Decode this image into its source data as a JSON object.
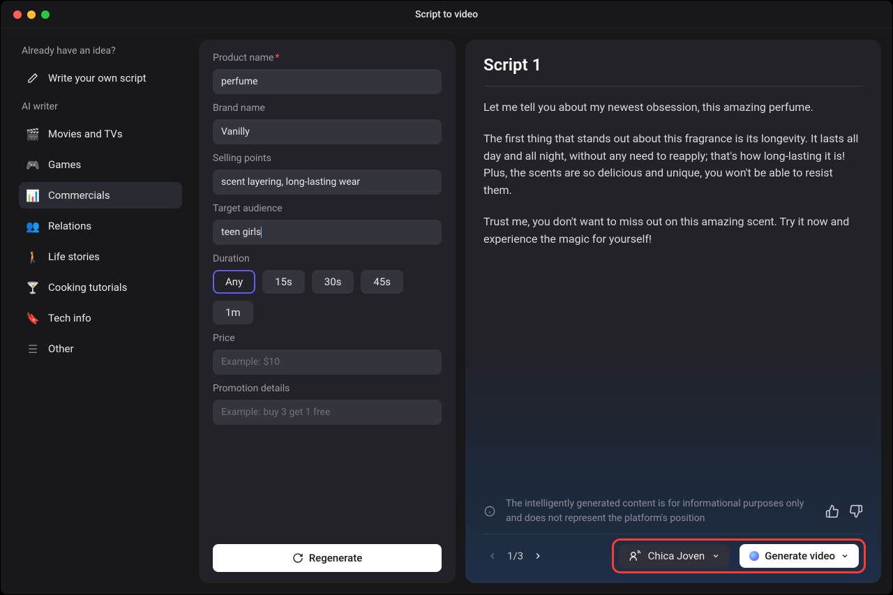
{
  "window": {
    "title": "Script to video"
  },
  "sidebar": {
    "idea_header": "Already have an idea?",
    "write_own": "Write your own script",
    "ai_header": "AI writer",
    "items": [
      {
        "icon": "movie",
        "label": "Movies and TVs"
      },
      {
        "icon": "game",
        "label": "Games"
      },
      {
        "icon": "commercial",
        "label": "Commercials"
      },
      {
        "icon": "relation",
        "label": "Relations"
      },
      {
        "icon": "life",
        "label": "Life stories"
      },
      {
        "icon": "cook",
        "label": "Cooking tutorials"
      },
      {
        "icon": "tech",
        "label": "Tech info"
      },
      {
        "icon": "other",
        "label": "Other"
      }
    ],
    "active_index": 2
  },
  "form": {
    "product_label": "Product name",
    "product_value": "perfume",
    "brand_label": "Brand name",
    "brand_value": "Vanilly",
    "selling_label": "Selling points",
    "selling_value": "scent layering, long-lasting wear",
    "audience_label": "Target audience",
    "audience_value": "teen girls",
    "duration_label": "Duration",
    "durations": [
      "Any",
      "15s",
      "30s",
      "45s",
      "1m"
    ],
    "duration_selected": "Any",
    "price_label": "Price",
    "price_placeholder": "Example: $10",
    "promo_label": "Promotion details",
    "promo_placeholder": "Example: buy 3 get 1 free",
    "regenerate_label": "Regenerate"
  },
  "script": {
    "title": "Script 1",
    "p1": "Let me tell you about my newest obsession, this amazing perfume.",
    "p2": "The first thing that stands out about this fragrance is its longevity. It lasts all day and all night, without any need to reapply; that's how long-lasting it is! Plus, the scents are so delicious and unique, you won't be able to resist them.",
    "p3": "Trust me, you don't want to miss out on this amazing scent. Try it now and experience the magic for yourself!",
    "disclaimer": "The intelligently generated content is for informational purposes only and does not represent the platform's position",
    "page_current": 1,
    "page_total": 3,
    "persona": "Chica Joven",
    "generate_label": "Generate video"
  }
}
